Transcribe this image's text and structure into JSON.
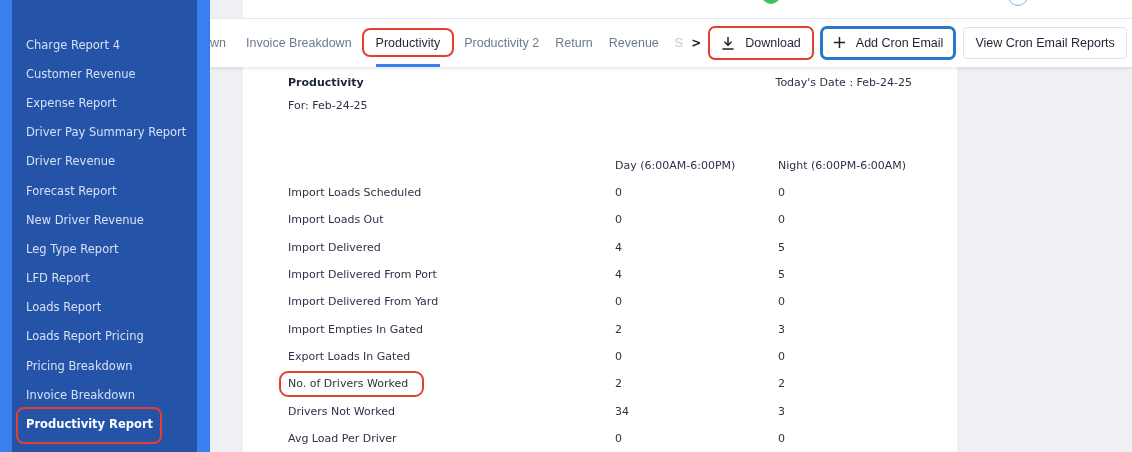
{
  "sidebar": {
    "items": [
      {
        "label": "Charge Report 4",
        "selected": false
      },
      {
        "label": "Customer Revenue",
        "selected": false
      },
      {
        "label": "Expense Report",
        "selected": false
      },
      {
        "label": "Driver Pay Summary Report",
        "selected": false
      },
      {
        "label": "Driver Revenue",
        "selected": false
      },
      {
        "label": "Forecast Report",
        "selected": false
      },
      {
        "label": "New Driver Revenue",
        "selected": false
      },
      {
        "label": "Leg Type Report",
        "selected": false
      },
      {
        "label": "LFD Report",
        "selected": false
      },
      {
        "label": "Loads Report",
        "selected": false
      },
      {
        "label": "Loads Report Pricing",
        "selected": false
      },
      {
        "label": "Pricing Breakdown",
        "selected": false
      },
      {
        "label": "Invoice Breakdown",
        "selected": false
      },
      {
        "label": "Productivity Report",
        "selected": true,
        "color": "#e2402f"
      }
    ]
  },
  "tabs": [
    {
      "label": "wn",
      "selected": false
    },
    {
      "label": "Invoice Breakdown",
      "selected": false
    },
    {
      "label": "Productivity",
      "selected": true,
      "color": "#e2402f"
    },
    {
      "label": "Productivity 2",
      "selected": false
    },
    {
      "label": "Return",
      "selected": false
    },
    {
      "label": "Revenue",
      "selected": false
    },
    {
      "label": "S",
      "selected": false
    }
  ],
  "tab_scroll": ">",
  "actions": [
    {
      "label": "Download",
      "kind": "download",
      "color": "#e2402f"
    },
    {
      "label": "Add Cron Email",
      "kind": "add",
      "color": "#2a78c8"
    },
    {
      "label": "View Cron Email Reports",
      "kind": "plain"
    }
  ],
  "report": {
    "title": "Productivity",
    "for": "For: Feb-24-25",
    "date": "Today's Date : Feb-24-25",
    "columns": [
      "Day (6:00AM-6:00PM)",
      "Night (6:00PM-6:00AM)"
    ],
    "rows": [
      {
        "label": "Import Loads Scheduled",
        "day": "0",
        "night": "0"
      },
      {
        "label": "Import Loads Out",
        "day": "0",
        "night": "0"
      },
      {
        "label": "Import Delivered",
        "day": "4",
        "night": "5"
      },
      {
        "label": "Import Delivered From Port",
        "day": "4",
        "night": "5"
      },
      {
        "label": "Import Delivered From Yard",
        "day": "0",
        "night": "0"
      },
      {
        "label": "Import Empties In Gated",
        "day": "2",
        "night": "3"
      },
      {
        "label": "Export Loads In Gated",
        "day": "0",
        "night": "0"
      },
      {
        "label": "No. of Drivers Worked",
        "day": "2",
        "night": "2",
        "color": "#e2402f"
      },
      {
        "label": "Drivers Not Worked",
        "day": "34",
        "night": "3"
      },
      {
        "label": "Avg Load Per Driver",
        "day": "0",
        "night": "0"
      }
    ]
  }
}
